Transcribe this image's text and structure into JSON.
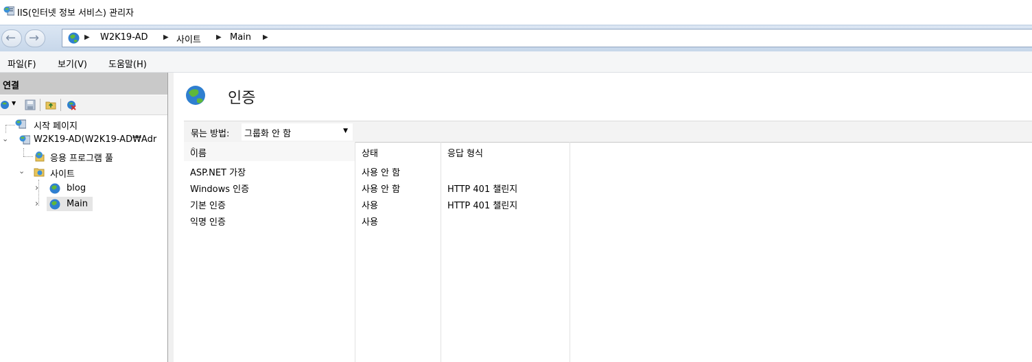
{
  "window": {
    "title": "IIS(인터넷 정보 서비스) 관리자"
  },
  "address": {
    "crumbs": [
      "W2K19-AD",
      "사이트",
      "Main"
    ]
  },
  "menu": {
    "items": [
      "파일(F)",
      "보기(V)",
      "도움말(H)"
    ]
  },
  "connections": {
    "header": "연결",
    "tree": [
      {
        "label": "시작 페이지"
      },
      {
        "label": "W2K19-AD(W2K19-AD₩Adr"
      },
      {
        "label": "응용 프로그램 풀"
      },
      {
        "label": "사이트"
      },
      {
        "label": "blog"
      },
      {
        "label": "Main"
      }
    ]
  },
  "content": {
    "title": "인증",
    "group_by_label": "묶는 방법:",
    "group_by_value": "그룹화 안 함",
    "columns": [
      "이름",
      "상태",
      "응답 형식"
    ],
    "rows": [
      {
        "name": "ASP.NET 가장",
        "status": "사용 안 함",
        "response": ""
      },
      {
        "name": "Windows 인증",
        "status": "사용 안 함",
        "response": "HTTP 401 챌린지"
      },
      {
        "name": "기본 인증",
        "status": "사용",
        "response": "HTTP 401 챌린지"
      },
      {
        "name": "익명 인증",
        "status": "사용",
        "response": ""
      }
    ]
  },
  "colors": {
    "selection": "#e5e5e5",
    "addressbar": "#dbe6f3",
    "header": "#c9c9c9"
  }
}
